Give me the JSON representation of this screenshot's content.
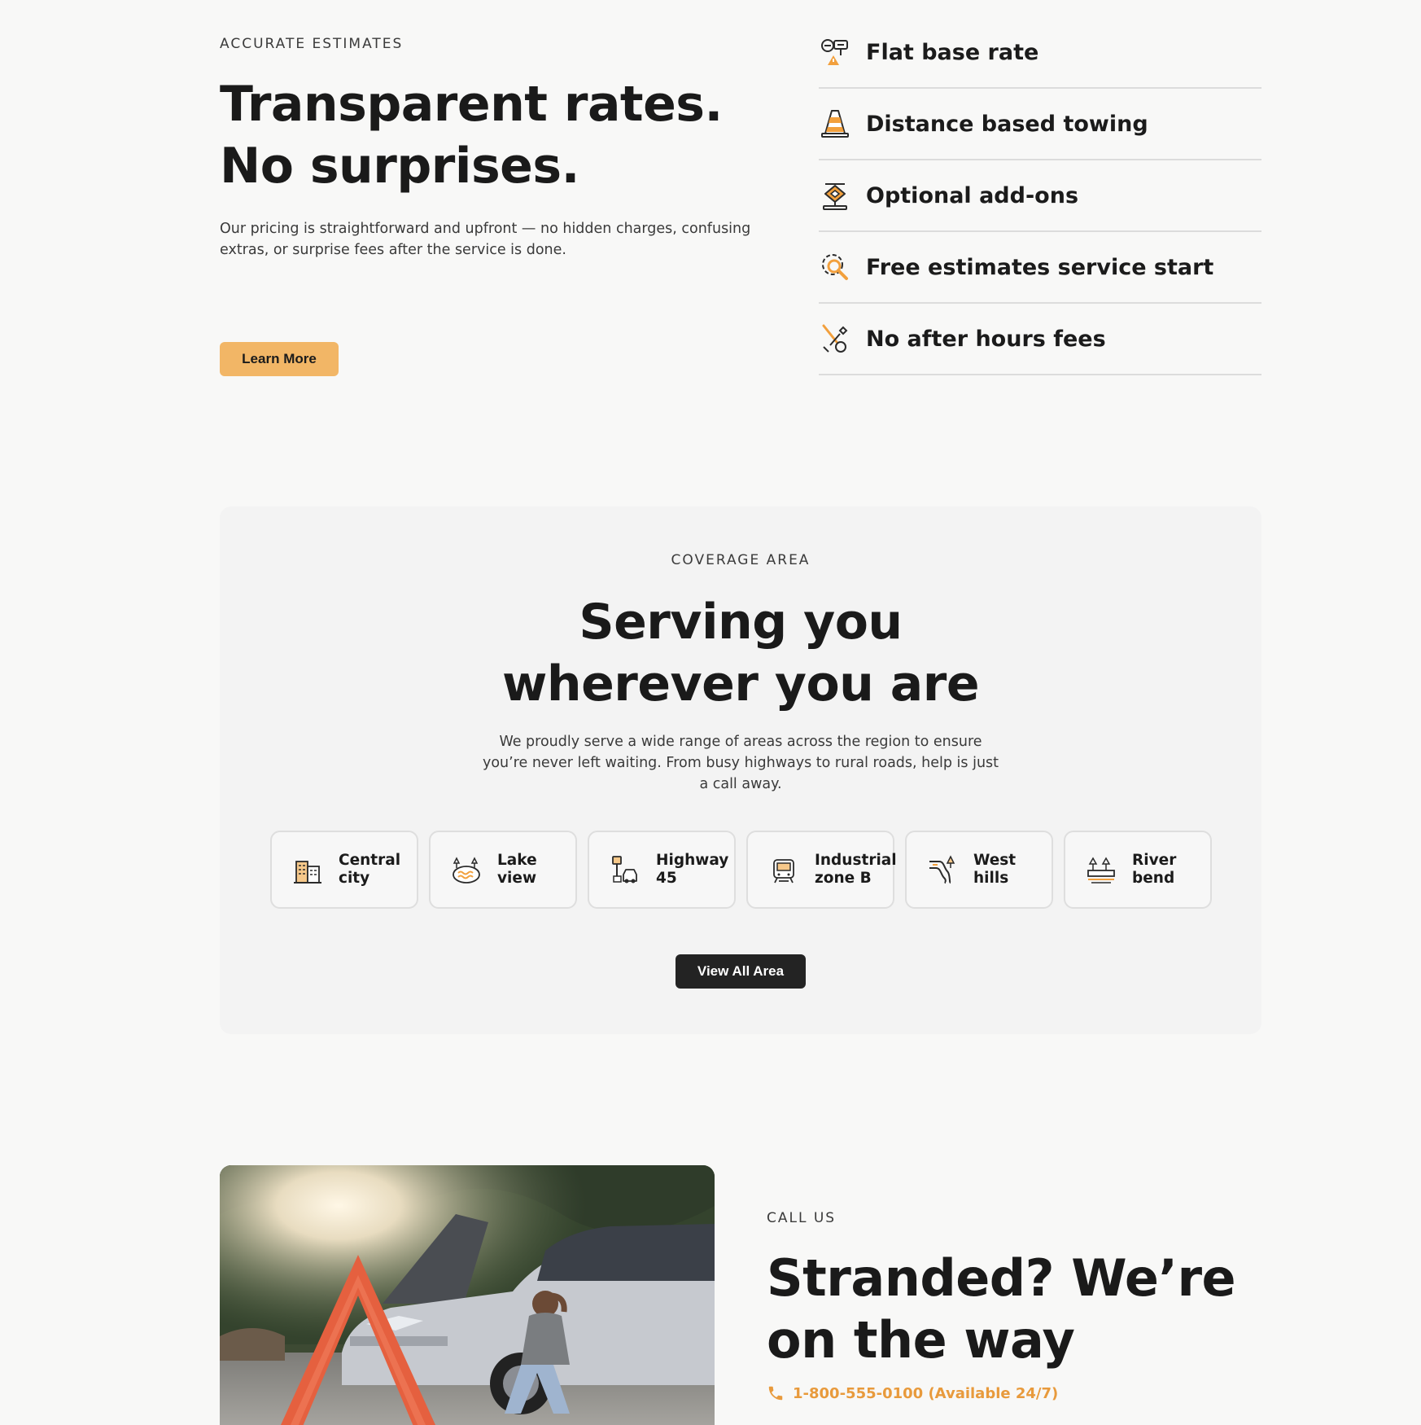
{
  "colors": {
    "accent": "#f2b666",
    "accent_text": "#e89a3c",
    "dark": "#1b1b1b",
    "panel": "#f3f3f3",
    "page": "#f8f8f7"
  },
  "estimates": {
    "eyebrow": "ACCURATE ESTIMATES",
    "title_line1": "Transparent rates.",
    "title_line2": "No surprises.",
    "description": "Our pricing is straightforward and upfront — no hidden charges, confusing extras, or surprise fees after the service is done.",
    "button_label": "Learn More",
    "features": [
      {
        "label": "Flat base rate",
        "icon": "road-sign-icon"
      },
      {
        "label": "Distance based towing",
        "icon": "traffic-cone-icon"
      },
      {
        "label": "Optional add-ons",
        "icon": "car-jack-icon"
      },
      {
        "label": "Free estimates service start",
        "icon": "gear-search-icon"
      },
      {
        "label": "No after hours fees",
        "icon": "tools-icon"
      }
    ]
  },
  "coverage": {
    "eyebrow": "COVERAGE AREA",
    "title_line1": "Serving you",
    "title_line2": "wherever you are",
    "description": "We proudly serve a wide range of areas across the region to ensure you’re never left waiting. From busy highways to rural roads, help is just a call away.",
    "areas": [
      {
        "line1": "Central",
        "line2": "city",
        "icon": "buildings-icon"
      },
      {
        "line1": "Lake",
        "line2": "view",
        "icon": "lake-icon"
      },
      {
        "line1": "Highway",
        "line2": "45",
        "icon": "highway-icon"
      },
      {
        "line1": "Industrial",
        "line2": "zone B",
        "icon": "factory-icon"
      },
      {
        "line1": "West",
        "line2": "hills",
        "icon": "hills-road-icon"
      },
      {
        "line1": "River",
        "line2": "bend",
        "icon": "river-bridge-icon"
      }
    ],
    "button_label": "View All Area"
  },
  "call": {
    "eyebrow": "CALL US",
    "title_line1": "Stranded? We’re",
    "title_line2": "on the way",
    "phone": "1-800-555-0100 (Available 24/7)",
    "photo": "stranded-driver-photo"
  }
}
